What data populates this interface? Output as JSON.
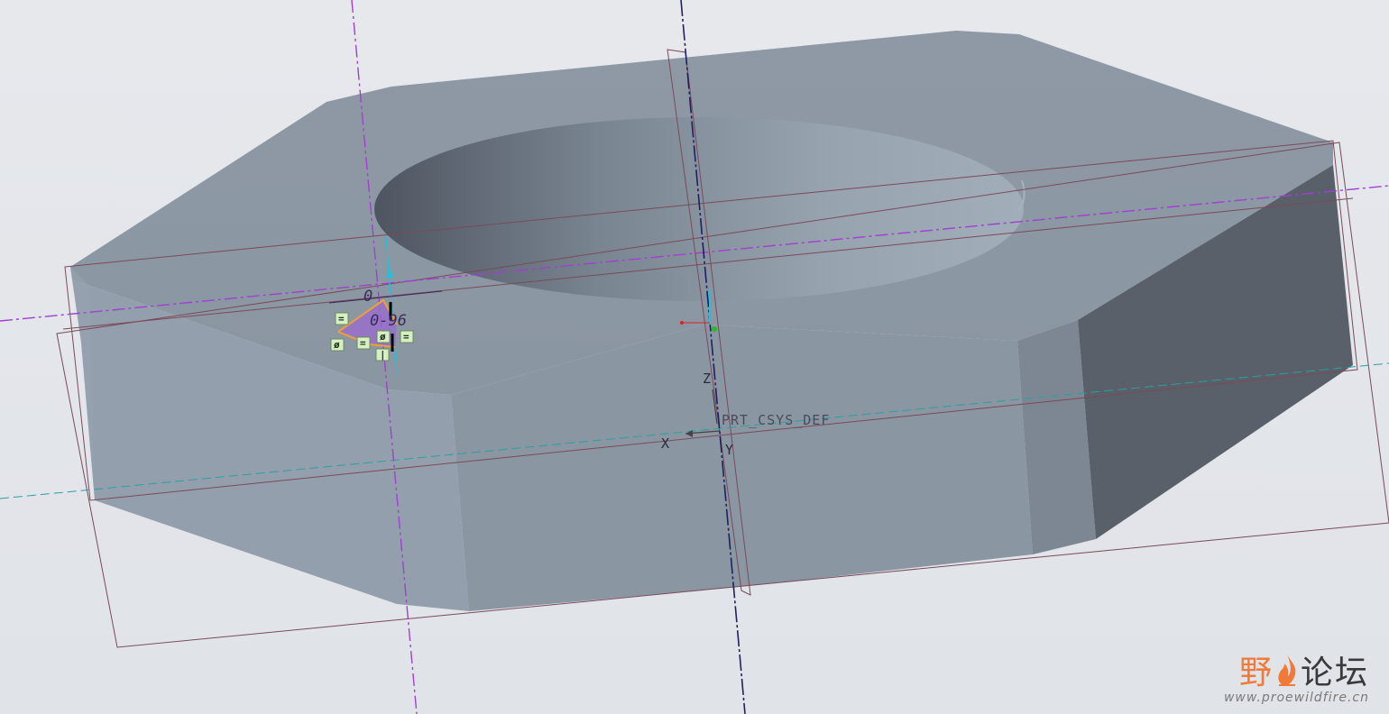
{
  "viewport": {
    "csys_label": "PRT_CSYS_DEF",
    "axes": {
      "x": "X",
      "y": "Y",
      "z": "Z"
    },
    "dimension_text": "0-96",
    "dimension_short": "0",
    "constraints": {
      "equal": "=",
      "parallel": "ø",
      "vertical": "|"
    }
  },
  "watermark": {
    "title_part1": "野",
    "title_part2": "论坛",
    "url": "www.proewildfire.cn",
    "logo_icon": "flame-icon"
  },
  "colors": {
    "background": "#e2e4e8",
    "model_top": "#8f9aa6",
    "model_front": "#8d98a5",
    "model_side_dark": "#596069",
    "datum_plane": "#7a4a5a",
    "datum_axis": "#a040d0",
    "csys_axis": "#202060",
    "sketch_orange": "#f0a030",
    "sketch_purple": "#9a6ad0",
    "watermark_accent": "#f07a3a"
  }
}
